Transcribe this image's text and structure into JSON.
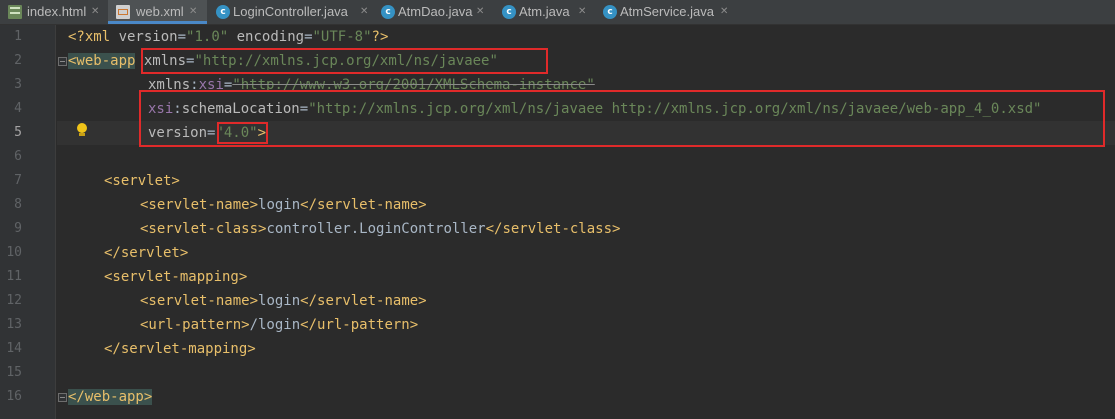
{
  "tabs": [
    {
      "name": "index.html",
      "icon": "html-file-icon",
      "active": false
    },
    {
      "name": "web.xml",
      "icon": "xml-file-icon",
      "active": true
    },
    {
      "name": "LoginController.java",
      "icon": "java-class-icon",
      "active": false
    },
    {
      "name": "AtmDao.java",
      "icon": "java-class-icon",
      "active": false
    },
    {
      "name": "Atm.java",
      "icon": "java-class-icon",
      "active": false
    },
    {
      "name": "AtmService.java",
      "icon": "java-class-icon",
      "active": false
    }
  ],
  "tab_close_glyph": "✕",
  "class_icon_letter": "c",
  "current_line": 5,
  "line_numbers": [
    "1",
    "2",
    "3",
    "4",
    "5",
    "6",
    "7",
    "8",
    "9",
    "10",
    "11",
    "12",
    "13",
    "14",
    "15",
    "16"
  ],
  "code": {
    "line1": {
      "open": "<?xml ",
      "v1_attr": "version",
      "v1_eq": "=",
      "v1_val": "\"1.0\"",
      "sp": " ",
      "enc_attr": "encoding",
      "enc_eq": "=",
      "enc_val": "\"UTF-8\"",
      "close": "?>"
    },
    "line2": {
      "tag": "<web-app",
      "attr": "xmlns",
      "eq": "=",
      "val": "\"http://xmlns.jcp.org/xml/ns/javaee\""
    },
    "line3": {
      "attr": "xmlns",
      "colon": ":",
      "ns": "xsi",
      "eq": "=",
      "val": "\"http://www.w3.org/2001/XMLSchema-instance\""
    },
    "line4": {
      "ns": "xsi",
      "colon": ":",
      "attr": "schemaLocation",
      "eq": "=",
      "val": "\"http://xmlns.jcp.org/xml/ns/javaee http://xmlns.jcp.org/xml/ns/javaee/web-app_4_0.xsd\""
    },
    "line5": {
      "attr": "version",
      "eq": "=",
      "val": "\"4.0\"",
      "close": ">"
    },
    "line7": {
      "tag": "<servlet>"
    },
    "line8": {
      "open": "<servlet-name>",
      "text": "login",
      "close": "</servlet-name>"
    },
    "line9": {
      "open": "<servlet-class>",
      "text": "controller.LoginController",
      "close": "</servlet-class>"
    },
    "line10": {
      "tag": "</servlet>"
    },
    "line11": {
      "tag": "<servlet-mapping>"
    },
    "line12": {
      "open": "<servlet-name>",
      "text": "login",
      "close": "</servlet-name>"
    },
    "line13": {
      "open": "<url-pattern>",
      "text": "/login",
      "close": "</url-pattern>"
    },
    "line14": {
      "tag": "</servlet-mapping>"
    },
    "line16": {
      "tag": "</web-app>"
    }
  },
  "colors": {
    "editor_bg": "#2b2b2b",
    "tag": "#e8bf6a",
    "attribute": "#bababa",
    "namespace": "#9876aa",
    "string": "#6a8759",
    "text": "#a9b7c6",
    "tag_match_highlight": "#3b514d",
    "annotation_box": "#e02a2a"
  }
}
